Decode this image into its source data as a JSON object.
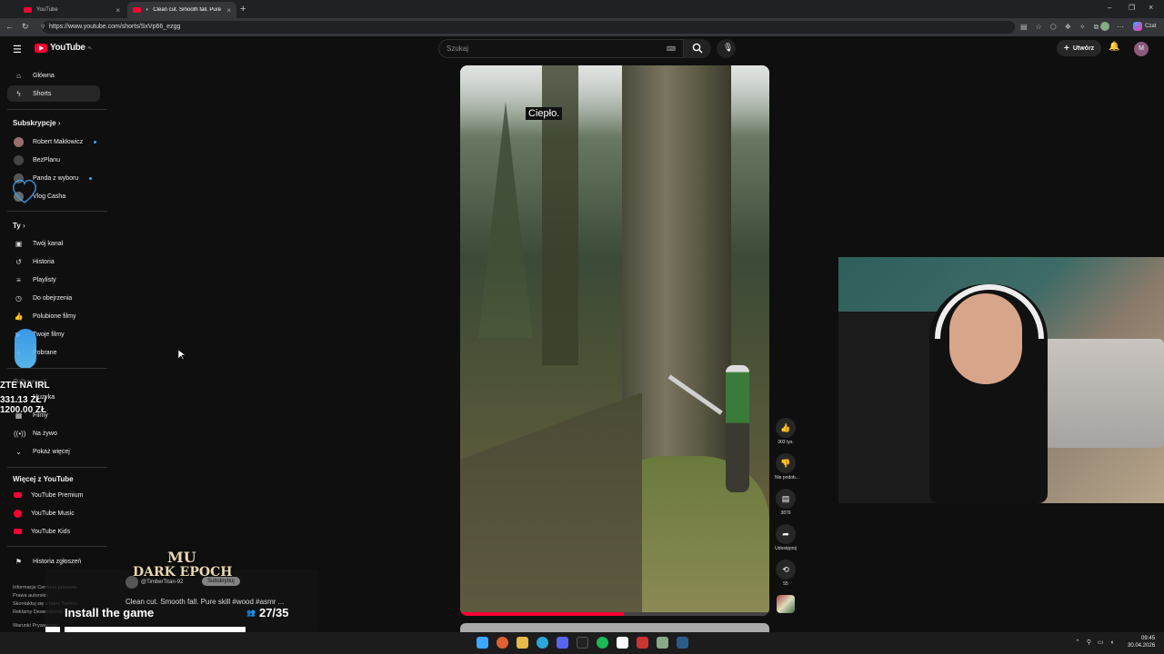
{
  "tabs": [
    {
      "label": "YouTube"
    },
    {
      "label": "Clean cut. Smooth fall. Pure s"
    }
  ],
  "browser": {
    "url": "https://www.youtube.com/shorts/SxVp66_ezgg",
    "copilot_label": "Czat"
  },
  "header": {
    "logo": "YouTube",
    "logo_region": "PL",
    "search_placeholder": "Szukaj",
    "create_label": "Utwórz",
    "account_initial": "M"
  },
  "sidebar": {
    "main": [
      {
        "label": "Główna",
        "icon": "home-icon"
      },
      {
        "label": "Shorts",
        "icon": "shorts-icon"
      }
    ],
    "subs_heading": "Subskrypcje",
    "subscriptions": [
      {
        "label": "Robert Makłowicz",
        "dot": true
      },
      {
        "label": "BezPlanu",
        "dot": false
      },
      {
        "label": "Panda z wyboru",
        "dot": true
      },
      {
        "label": "Vlog Casha",
        "dot": false
      }
    ],
    "you_heading": "Ty",
    "you": [
      {
        "label": "Twój kanał",
        "icon": "channel-icon"
      },
      {
        "label": "Historia",
        "icon": "history-icon"
      },
      {
        "label": "Playlisty",
        "icon": "playlist-icon"
      },
      {
        "label": "Do obejrzenia",
        "icon": "clock-icon"
      },
      {
        "label": "Polubione filmy",
        "icon": "like-icon"
      },
      {
        "label": "Twoje filmy",
        "icon": "video-icon"
      },
      {
        "label": "Pobrane",
        "icon": "download-icon"
      }
    ],
    "explore_heading": "Odkrywaj",
    "explore": [
      {
        "label": "Muzyka",
        "icon": "music-icon"
      },
      {
        "label": "Filmy",
        "icon": "film-icon"
      },
      {
        "label": "Na żywo",
        "icon": "live-icon"
      },
      {
        "label": "Pokaż więcej",
        "icon": "chevron-down-icon"
      }
    ],
    "more_heading": "Więcej z YouTube",
    "more": [
      {
        "label": "YouTube Premium"
      },
      {
        "label": "YouTube Music"
      },
      {
        "label": "YouTube Kids"
      }
    ],
    "report_label": "Historia zgłoszeń",
    "footer": [
      "Informacje   Centrum prasowe",
      "Prawa autorskie",
      "Skontaktuj się z nami   Twórcy",
      "Reklamy   Deweloperzy",
      "Warunki   Prywatność"
    ]
  },
  "short": {
    "caption": "Ciepło.",
    "channel": "@TimberTitan-92",
    "subscribe_label": "Subskrybuj",
    "title": "Clean cut. Smooth fall. Pure skill #wood #asmr ...",
    "likes": "303 tys.",
    "dislike_label": "Nie podob...",
    "comments": "3876",
    "share_label": "Udostępnij",
    "remix_count": "55",
    "progress": 0.53
  },
  "stream_overlay": {
    "donation_title": "ZTE NA IRL",
    "donation_current": "331.13 ZŁ /",
    "donation_goal": "1200.00 ZŁ",
    "ad_logo_top": "MU",
    "ad_logo_bottom": "DARK EPOCH",
    "ad_cta": "Install the game",
    "ad_counter": "27/35"
  },
  "taskbar": {
    "time": "09:45",
    "date": "30.04.2026"
  }
}
